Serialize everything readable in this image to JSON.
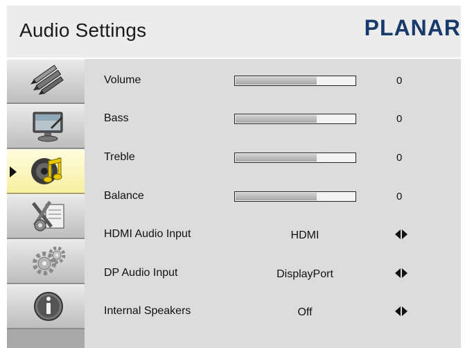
{
  "header": {
    "title": "Audio Settings",
    "brand": "PLANAR"
  },
  "sidebar": {
    "items": [
      {
        "icon": "pens-icon",
        "selected": false
      },
      {
        "icon": "monitor-icon",
        "selected": false
      },
      {
        "icon": "speaker-music-icon",
        "selected": true
      },
      {
        "icon": "tools-icon",
        "selected": false
      },
      {
        "icon": "gears-icon",
        "selected": false
      },
      {
        "icon": "info-icon",
        "selected": false
      }
    ]
  },
  "settings": [
    {
      "label": "Volume",
      "type": "slider",
      "value": "0",
      "level": 0.68
    },
    {
      "label": "Bass",
      "type": "slider",
      "value": "0",
      "level": 0.68
    },
    {
      "label": "Treble",
      "type": "slider",
      "value": "0",
      "level": 0.68
    },
    {
      "label": "Balance",
      "type": "slider",
      "value": "0",
      "level": 0.68
    },
    {
      "label": "HDMI Audio Input",
      "type": "option",
      "value": "HDMI"
    },
    {
      "label": "DP Audio Input",
      "type": "option",
      "value": "DisplayPort"
    },
    {
      "label": "Internal Speakers",
      "type": "option",
      "value": "Off"
    }
  ]
}
